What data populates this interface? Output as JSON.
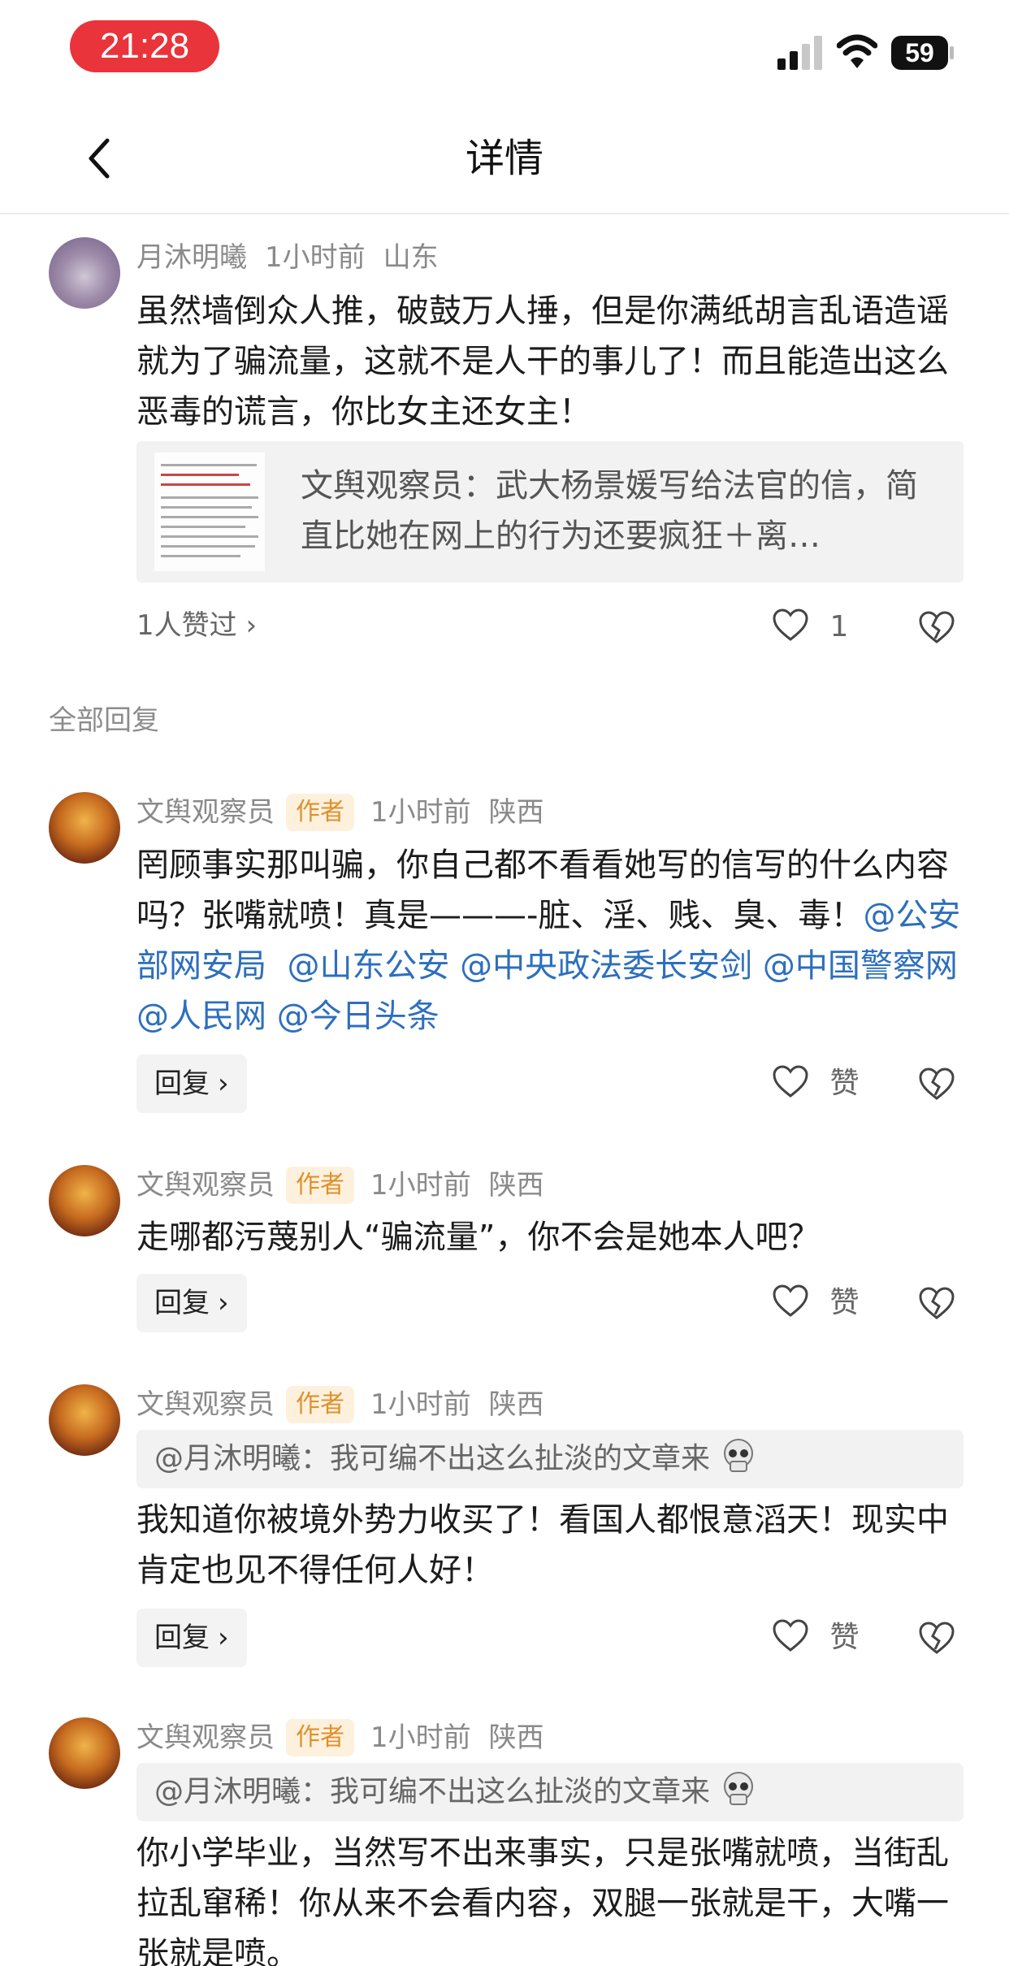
{
  "status_bar": {
    "time": "21:28",
    "battery": "59"
  },
  "nav": {
    "title": "详情"
  },
  "main_comment": {
    "user": "月沐明曦",
    "time": "1小时前",
    "location": "山东",
    "text": "虽然墙倒众人推，破鼓万人捶，但是你满纸胡言乱语造谣就为了骗流量，这就不是人干的事儿了！而且能造出这么恶毒的谎言，你比女主还女主！",
    "link_title": "文舆观察员：武大杨景媛写给法官的信，简直比她在网上的行为还要疯狂＋离…",
    "liked_by": "1人赞过",
    "like_count": "1"
  },
  "section": {
    "all_replies": "全部回复"
  },
  "replies": [
    {
      "user": "文舆观察员",
      "badge": "作者",
      "time": "1小时前",
      "location": "陕西",
      "text_plain": "罔顾事实那叫骗，你自己都不看看她写的信写的什么内容吗？张嘴就喷！真是———-脏、淫、贱、臭、毒！",
      "mentions": [
        "@公安部网安局",
        "@山东公安",
        "@中央政法委长安剑",
        "@中国警察网",
        "@人民网",
        "@今日头条"
      ],
      "reply_label": "回复",
      "like_label": "赞"
    },
    {
      "user": "文舆观察员",
      "badge": "作者",
      "time": "1小时前",
      "location": "陕西",
      "text": "走哪都污蔑别人“骗流量”，你不会是她本人吧？",
      "reply_label": "回复",
      "like_label": "赞"
    },
    {
      "user": "文舆观察员",
      "badge": "作者",
      "time": "1小时前",
      "location": "陕西",
      "quote": "@月沐明曦：我可编不出这么扯淡的文章来",
      "text": "我知道你被境外势力收买了！看国人都恨意滔天！现实中肯定也见不得任何人好！",
      "reply_label": "回复",
      "like_label": "赞"
    },
    {
      "user": "文舆观察员",
      "badge": "作者",
      "time": "1小时前",
      "location": "陕西",
      "quote": "@月沐明曦：我可编不出这么扯淡的文章来",
      "text": "你小学毕业，当然写不出来事实，只是张嘴就喷，当街乱拉乱窜稀！你从来不会看内容，双腿一张就是干，大嘴一张就是喷。"
    }
  ]
}
